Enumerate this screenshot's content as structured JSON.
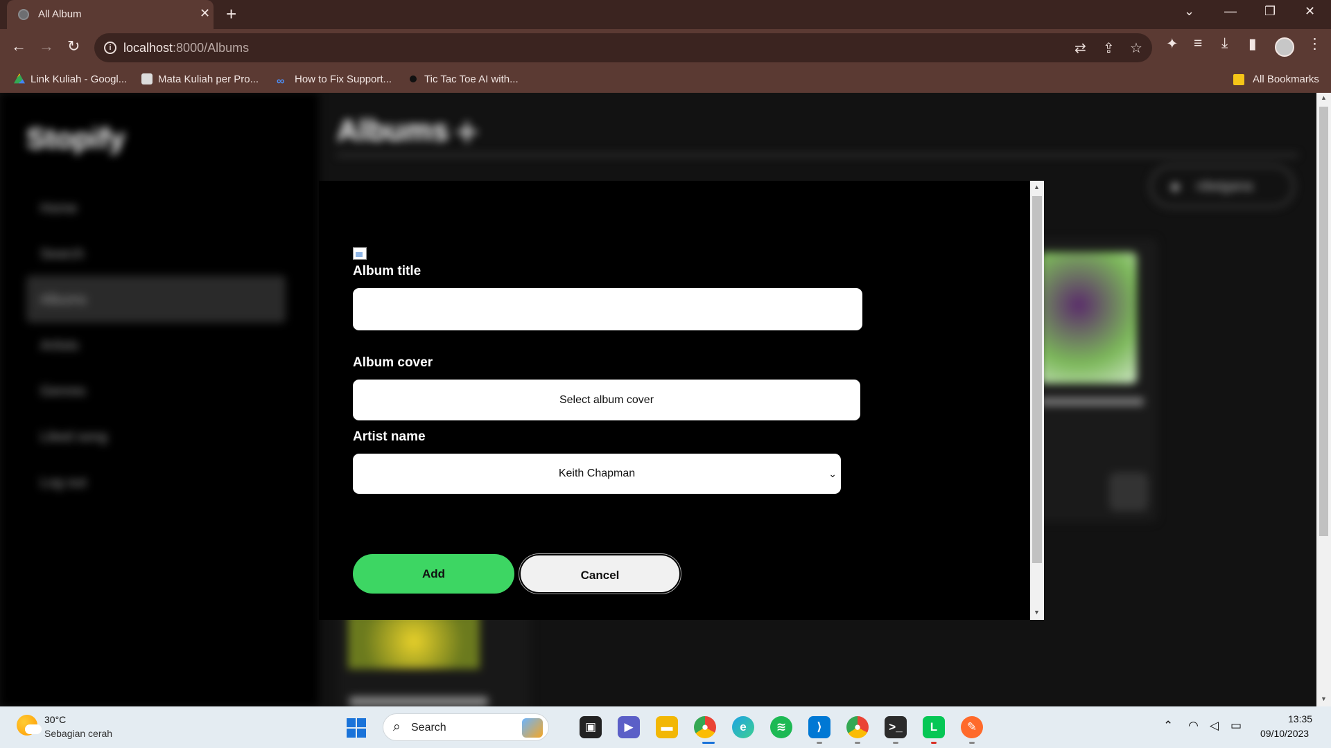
{
  "browser": {
    "tab_title": "All Album",
    "url_host": "localhost",
    "url_path": ":8000/Albums",
    "bookmarks": [
      {
        "label": "Link Kuliah - Googl...",
        "icon": "google-drive-icon"
      },
      {
        "label": "Mata Kuliah per Pro...",
        "icon": "site-favicon"
      },
      {
        "label": "How to Fix Support...",
        "icon": "meta-infinity-icon"
      },
      {
        "label": "Tic Tac Toe AI with...",
        "icon": "site-favicon-dark"
      }
    ],
    "all_bookmarks": "All Bookmarks"
  },
  "app": {
    "logo": "Stopify",
    "sidebar": [
      "Home",
      "Search",
      "Albums",
      "Artists",
      "Genres",
      "Liked song",
      "Log out"
    ],
    "active_item": "Albums",
    "heading": "Albums",
    "user_name": "rdwigana"
  },
  "modal": {
    "title_label": "Album title",
    "title_value": "",
    "cover_label": "Album cover",
    "cover_button": "Select album cover",
    "artist_label": "Artist name",
    "artist_selected": "Keith Chapman",
    "add_button": "Add",
    "cancel_button": "Cancel"
  },
  "taskbar": {
    "weather_temp": "30°C",
    "weather_desc": "Sebagian cerah",
    "search_placeholder": "Search",
    "time": "13:35",
    "date": "09/10/2023",
    "colors": {
      "spotify": "#1db954",
      "vscode": "#0078d4",
      "line": "#06c755",
      "brave": "#ff6a2b"
    }
  }
}
